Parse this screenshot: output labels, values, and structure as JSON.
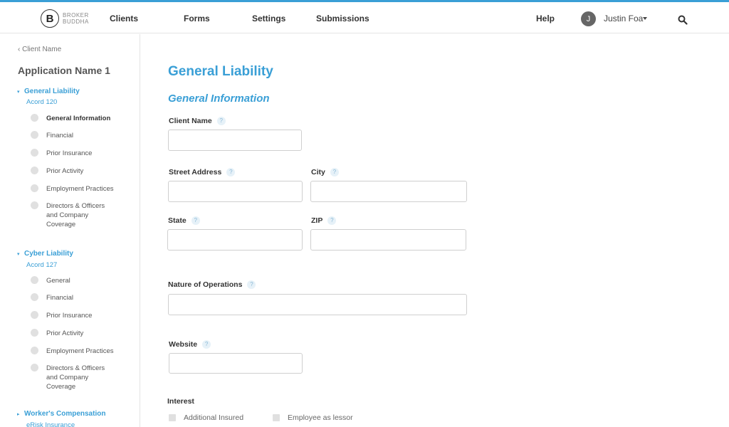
{
  "brand": {
    "mark": "B",
    "line1": "BROKER",
    "line2": "BUDDHA"
  },
  "nav": {
    "clients": "Clients",
    "forms": "Forms",
    "settings": "Settings",
    "submissions": "Submissions",
    "help": "Help"
  },
  "user": {
    "initial": "J",
    "name": "Justin Foa"
  },
  "sidebar": {
    "back": "Client Name",
    "app_name": "Application Name 1",
    "sections": [
      {
        "title": "General Liability",
        "sub": "Acord 120",
        "steps": [
          "General Information",
          "Financial",
          "Prior Insurance",
          "Prior Activity",
          "Employment Practices",
          "Directors & Officers and Company Coverage"
        ]
      },
      {
        "title": "Cyber Liability",
        "sub": "Acord 127",
        "steps": [
          "General",
          "Financial",
          "Prior Insurance",
          "Prior Activity",
          "Employment Practices",
          "Directors & Officers and Company Coverage"
        ]
      },
      {
        "title": "Worker's Compensation",
        "sub": "eRisk Insurance"
      }
    ]
  },
  "main": {
    "title": "General Liability",
    "section": "General Information",
    "help_glyph": "?",
    "fields": {
      "client_name": "Client Name",
      "street": "Street Address",
      "city": "City",
      "state": "State",
      "zip": "ZIP",
      "nature": "Nature of Operations",
      "website": "Website"
    },
    "interest": {
      "label": "Interest",
      "options": [
        "Additional Insured",
        "Employee as lessor"
      ]
    }
  },
  "colors": {
    "accent": "#3a9fd6",
    "text": "#333333",
    "border": "#cfcfcf",
    "dot": "#e0e0e0"
  }
}
